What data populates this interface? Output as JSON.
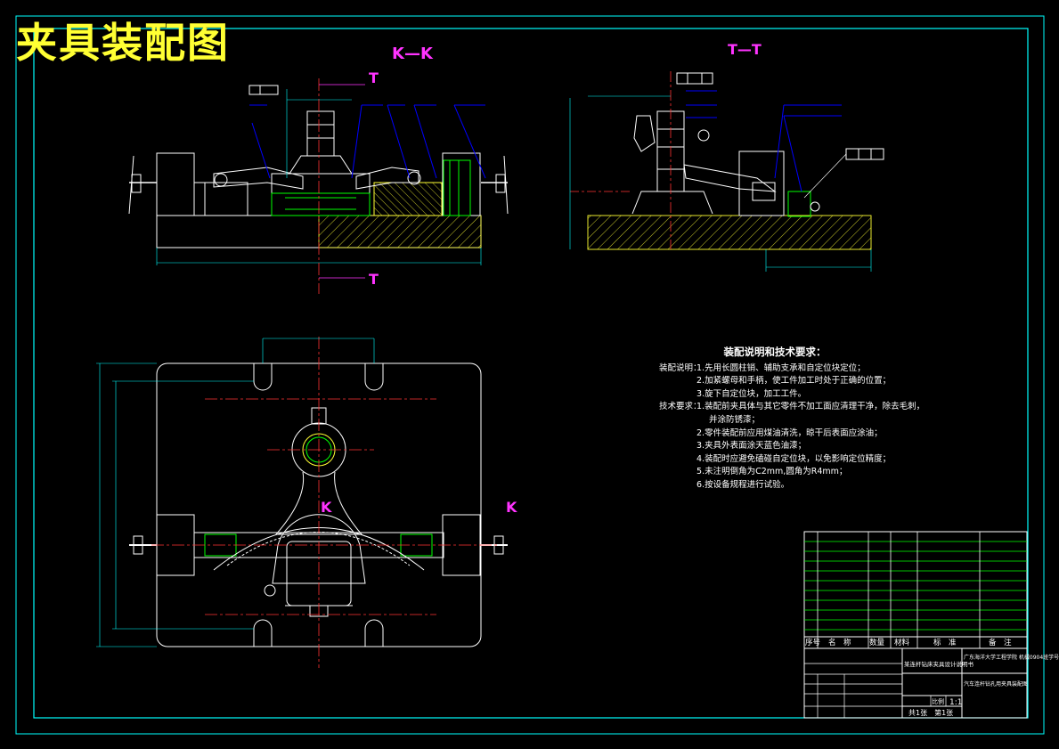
{
  "drawing": {
    "title": "夹具装配图",
    "section_labels": {
      "kk": "K—K",
      "tt": "T—T",
      "t_top": "T",
      "t_bottom": "T",
      "k_left": "K",
      "k_right": "K"
    }
  },
  "notes": {
    "title": "装配说明和技术要求：",
    "assembly_label": "装配说明：",
    "assembly": [
      "1.先用长圆柱销、辅助支承和自定位块定位；",
      "2.加紧螺母和手柄，使工件加工时处于正确的位置；",
      "3.旋下自定位块，加工工件。"
    ],
    "tech_label": "技术要求：",
    "tech": [
      "1.装配前夹具体与其它零件不加工面应清理干净，除去毛刺，",
      "并涂防锈漆；",
      "2.零件装配前应用煤油清洗，晾干后表面应涂油；",
      "3.夹具外表面涂天蓝色油漆；",
      "4.装配时应避免磕碰自定位块，以免影响定位精度；",
      "5.未注明倒角为C2mm,圆角为R4mm；",
      "6.按设备规程进行试验。"
    ]
  },
  "title_block": {
    "header": [
      "序号",
      "名　称",
      "数量",
      "材料",
      "标　准",
      "备　注"
    ],
    "school": "广东海洋大学工程学院 机械0904班学号",
    "project": "某连杆钻床夹具设计说明书",
    "part_name": "汽车连杆钻孔用夹具装配图",
    "sheets": "共1张　第1张",
    "scale": "1:1",
    "scale_label": "比例"
  }
}
